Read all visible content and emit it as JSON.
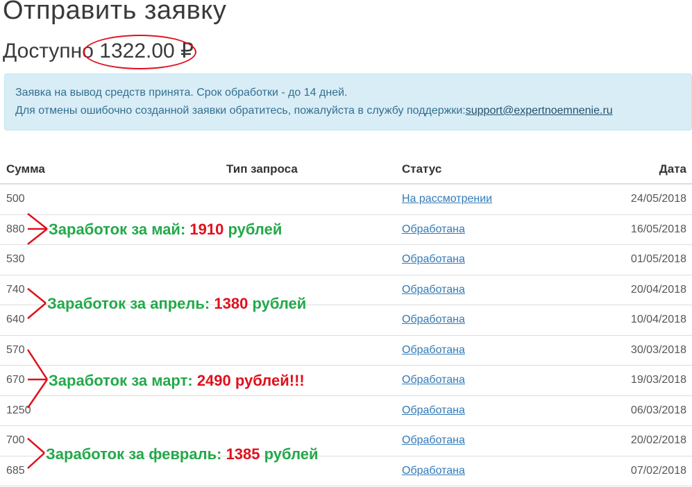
{
  "header": {
    "title": "Отправить заявку",
    "balance_label": "Доступно",
    "balance_value": "1322.00 ₽"
  },
  "alert": {
    "line1": "Заявка на вывод средств принята. Срок обработки - до 14 дней.",
    "line2_prefix": "Для отмены ошибочно созданной заявки обратитесь, пожалуйста в службу поддержки:",
    "email": "support@expertnoemnenie.ru"
  },
  "table": {
    "headers": {
      "sum": "Сумма",
      "type": "Тип запроса",
      "status": "Статус",
      "date": "Дата"
    },
    "rows": [
      {
        "sum": "500",
        "type": "",
        "status": "На рассмотрении",
        "date": "24/05/2018"
      },
      {
        "sum": "880",
        "type": "",
        "status": "Обработана",
        "date": "16/05/2018"
      },
      {
        "sum": "530",
        "type": "",
        "status": "Обработана",
        "date": "01/05/2018"
      },
      {
        "sum": "740",
        "type": "",
        "status": "Обработана",
        "date": "20/04/2018"
      },
      {
        "sum": "640",
        "type": "",
        "status": "Обработана",
        "date": "10/04/2018"
      },
      {
        "sum": "570",
        "type": "",
        "status": "Обработана",
        "date": "30/03/2018"
      },
      {
        "sum": "670",
        "type": "",
        "status": "Обработана",
        "date": "19/03/2018"
      },
      {
        "sum": "1250",
        "type": "",
        "status": "Обработана",
        "date": "06/03/2018"
      },
      {
        "sum": "700",
        "type": "",
        "status": "Обработана",
        "date": "20/02/2018"
      },
      {
        "sum": "685",
        "type": "",
        "status": "Обработана",
        "date": "07/02/2018"
      }
    ]
  },
  "annotations": {
    "may": {
      "text": "Заработок за май:",
      "amount": "1910",
      "suffix": "рублей"
    },
    "april": {
      "text": "Заработок за апрель:",
      "amount": "1380",
      "suffix": "рублей"
    },
    "march": {
      "text": "Заработок за март:",
      "amount": "2490 рублей!!!",
      "suffix": ""
    },
    "february": {
      "text": "Заработок за февраль:",
      "amount": "1385",
      "suffix": "рублей"
    }
  },
  "colors": {
    "annotation_green": "#23a94a",
    "annotation_red": "#e0101c",
    "link": "#337ab7",
    "alert_bg": "#d9edf7"
  }
}
